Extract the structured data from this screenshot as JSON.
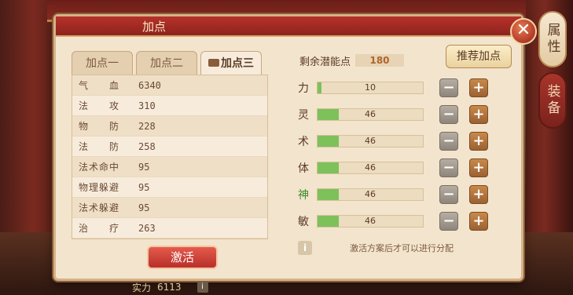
{
  "panel": {
    "title": "加点",
    "close_symbol": "✕"
  },
  "side_tabs": {
    "attributes": "属性",
    "equipment": "装备"
  },
  "scheme_tabs": [
    {
      "label": "加点一"
    },
    {
      "label": "加点二"
    },
    {
      "label": "加点三",
      "icon": "box-icon",
      "active": true
    }
  ],
  "stats": [
    {
      "label": "气　　血",
      "value": "6340"
    },
    {
      "label": "法　　攻",
      "value": "310"
    },
    {
      "label": "物　　防",
      "value": "228"
    },
    {
      "label": "法　　防",
      "value": "258"
    },
    {
      "label": "法术命中",
      "value": "95"
    },
    {
      "label": "物理躲避",
      "value": "95"
    },
    {
      "label": "法术躲避",
      "value": "95"
    },
    {
      "label": "治　　疗",
      "value": "263"
    }
  ],
  "activate_label": "激活",
  "potential": {
    "label": "剩余潜能点",
    "value": "180"
  },
  "recommend_label": "推荐加点",
  "attributes": [
    {
      "name": "力",
      "value": "10",
      "fill": 0.04
    },
    {
      "name": "灵",
      "value": "46",
      "fill": 0.2
    },
    {
      "name": "术",
      "value": "46",
      "fill": 0.2
    },
    {
      "name": "体",
      "value": "46",
      "fill": 0.2
    },
    {
      "name": "神",
      "value": "46",
      "fill": 0.2
    },
    {
      "name": "敏",
      "value": "46",
      "fill": 0.2
    }
  ],
  "button_symbols": {
    "minus": "−",
    "plus": "+"
  },
  "info": {
    "icon": "i",
    "text": "激活方案后才可以进行分配"
  },
  "footer": {
    "power_label": "实力",
    "power_value": "6113",
    "info_icon": "i"
  },
  "colors": {
    "accent_red": "#b7322a",
    "bar_fill": "#7cc15a",
    "plus_button": "#c8894a",
    "minus_button": "#9e958b"
  }
}
